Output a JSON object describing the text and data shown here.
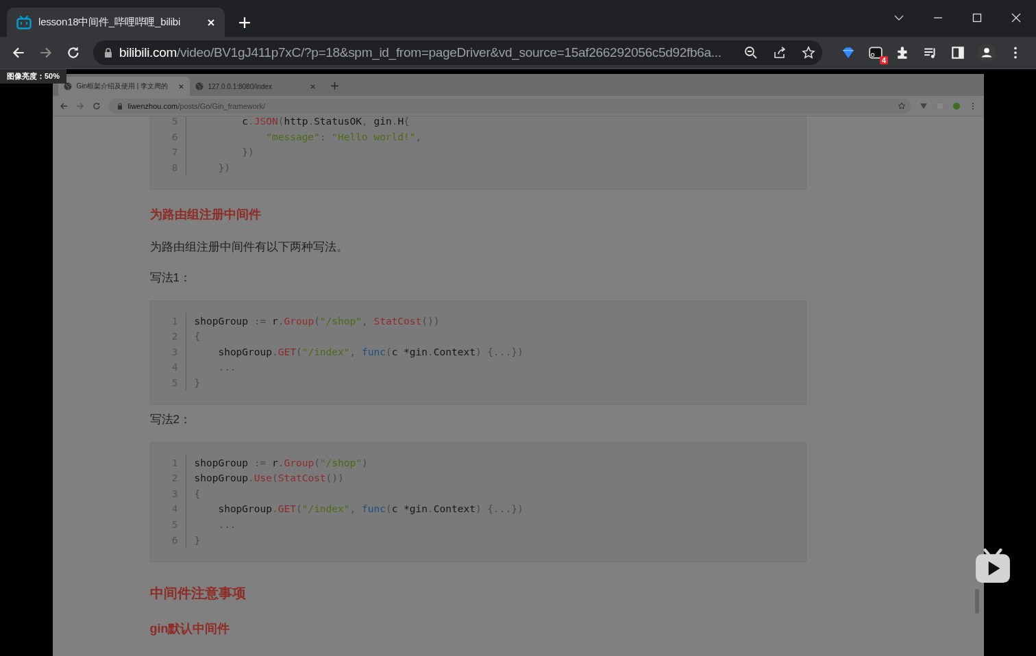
{
  "browser": {
    "tab": {
      "title": "lesson18中间件_哔哩哔哩_bilibi",
      "selected": true
    },
    "url_host": "bilibili.com",
    "url_path": "/video/BV1gJ411p7xC/?p=18&spm_id_from=pageDriver&vd_source=15af266292056c5d92fb6a...",
    "extension_badge": "4"
  },
  "player": {
    "brightness_label": "图像亮度：50%"
  },
  "inner_browser": {
    "tabs": [
      {
        "title": "Gin框架介绍及使用 | 李文周的",
        "selected": true
      },
      {
        "title": "127.0.0.1:8080/index",
        "selected": false
      }
    ],
    "url_host": "liwenzhou.com",
    "url_path": "/posts/Go/Gin_framework/"
  },
  "article": [
    {
      "kind": "code",
      "cut_top": true,
      "lines": [
        {
          "number": "5",
          "tokens": [
            {
              "t": "        c",
              "kind": "plain"
            },
            {
              "t": ".",
              "kind": "punct"
            },
            {
              "t": "JSON",
              "kind": "fn"
            },
            {
              "t": "(",
              "kind": "punct"
            },
            {
              "t": "http",
              "kind": "plain"
            },
            {
              "t": ".",
              "kind": "punct"
            },
            {
              "t": "StatusOK",
              "kind": "plain"
            },
            {
              "t": ", ",
              "kind": "punct"
            },
            {
              "t": "gin",
              "kind": "plain"
            },
            {
              "t": ".",
              "kind": "punct"
            },
            {
              "t": "H",
              "kind": "plain"
            },
            {
              "t": "{",
              "kind": "punct"
            }
          ]
        },
        {
          "number": "6",
          "tokens": [
            {
              "t": "            \"message\"",
              "kind": "str"
            },
            {
              "t": ": ",
              "kind": "punct"
            },
            {
              "t": "\"Hello world!\"",
              "kind": "str"
            },
            {
              "t": ",",
              "kind": "punct"
            }
          ]
        },
        {
          "number": "7",
          "tokens": [
            {
              "t": "        })",
              "kind": "punct"
            }
          ]
        },
        {
          "number": "8",
          "tokens": [
            {
              "t": "    })",
              "kind": "punct"
            }
          ]
        }
      ]
    },
    {
      "kind": "h3",
      "text": "为路由组注册中间件"
    },
    {
      "kind": "paragraph",
      "text": "为路由组注册中间件有以下两种写法。"
    },
    {
      "kind": "paragraph",
      "text": "写法1："
    },
    {
      "kind": "code",
      "cut_top": false,
      "lines": [
        {
          "number": "1",
          "tokens": [
            {
              "t": "shopGroup",
              "kind": "plain"
            },
            {
              "t": " := ",
              "kind": "punct"
            },
            {
              "t": "r",
              "kind": "plain"
            },
            {
              "t": ".",
              "kind": "punct"
            },
            {
              "t": "Group",
              "kind": "fn"
            },
            {
              "t": "(",
              "kind": "punct"
            },
            {
              "t": "\"/shop\"",
              "kind": "str"
            },
            {
              "t": ", ",
              "kind": "punct"
            },
            {
              "t": "StatCost",
              "kind": "fn"
            },
            {
              "t": "())",
              "kind": "punct"
            }
          ]
        },
        {
          "number": "2",
          "tokens": [
            {
              "t": "{",
              "kind": "punct"
            }
          ]
        },
        {
          "number": "3",
          "tokens": [
            {
              "t": "    shopGroup",
              "kind": "plain"
            },
            {
              "t": ".",
              "kind": "punct"
            },
            {
              "t": "GET",
              "kind": "fn"
            },
            {
              "t": "(",
              "kind": "punct"
            },
            {
              "t": "\"/index\"",
              "kind": "str"
            },
            {
              "t": ", ",
              "kind": "punct"
            },
            {
              "t": "func",
              "kind": "kw"
            },
            {
              "t": "(",
              "kind": "punct"
            },
            {
              "t": "c *gin",
              "kind": "plain"
            },
            {
              "t": ".",
              "kind": "punct"
            },
            {
              "t": "Context",
              "kind": "plain"
            },
            {
              "t": ") {...})",
              "kind": "punct"
            }
          ]
        },
        {
          "number": "4",
          "tokens": [
            {
              "t": "    ...",
              "kind": "punct"
            }
          ]
        },
        {
          "number": "5",
          "tokens": [
            {
              "t": "}",
              "kind": "punct"
            }
          ]
        }
      ]
    },
    {
      "kind": "paragraph",
      "text": "写法2："
    },
    {
      "kind": "code",
      "cut_top": false,
      "lines": [
        {
          "number": "1",
          "tokens": [
            {
              "t": "shopGroup",
              "kind": "plain"
            },
            {
              "t": " := ",
              "kind": "punct"
            },
            {
              "t": "r",
              "kind": "plain"
            },
            {
              "t": ".",
              "kind": "punct"
            },
            {
              "t": "Group",
              "kind": "fn"
            },
            {
              "t": "(",
              "kind": "punct"
            },
            {
              "t": "\"/shop\"",
              "kind": "str"
            },
            {
              "t": ")",
              "kind": "punct"
            }
          ]
        },
        {
          "number": "2",
          "tokens": [
            {
              "t": "shopGroup",
              "kind": "plain"
            },
            {
              "t": ".",
              "kind": "punct"
            },
            {
              "t": "Use",
              "kind": "fn"
            },
            {
              "t": "(",
              "kind": "punct"
            },
            {
              "t": "StatCost",
              "kind": "fn"
            },
            {
              "t": "())",
              "kind": "punct"
            }
          ]
        },
        {
          "number": "3",
          "tokens": [
            {
              "t": "{",
              "kind": "punct"
            }
          ]
        },
        {
          "number": "4",
          "tokens": [
            {
              "t": "    shopGroup",
              "kind": "plain"
            },
            {
              "t": ".",
              "kind": "punct"
            },
            {
              "t": "GET",
              "kind": "fn"
            },
            {
              "t": "(",
              "kind": "punct"
            },
            {
              "t": "\"/index\"",
              "kind": "str"
            },
            {
              "t": ", ",
              "kind": "punct"
            },
            {
              "t": "func",
              "kind": "kw"
            },
            {
              "t": "(",
              "kind": "punct"
            },
            {
              "t": "c *gin",
              "kind": "plain"
            },
            {
              "t": ".",
              "kind": "punct"
            },
            {
              "t": "Context",
              "kind": "plain"
            },
            {
              "t": ") {...})",
              "kind": "punct"
            }
          ]
        },
        {
          "number": "5",
          "tokens": [
            {
              "t": "    ...",
              "kind": "punct"
            }
          ]
        },
        {
          "number": "6",
          "tokens": [
            {
              "t": "}",
              "kind": "punct"
            }
          ]
        }
      ]
    },
    {
      "kind": "h2",
      "text": "中间件注意事项"
    },
    {
      "kind": "h3small",
      "text": "gin默认中间件"
    }
  ]
}
